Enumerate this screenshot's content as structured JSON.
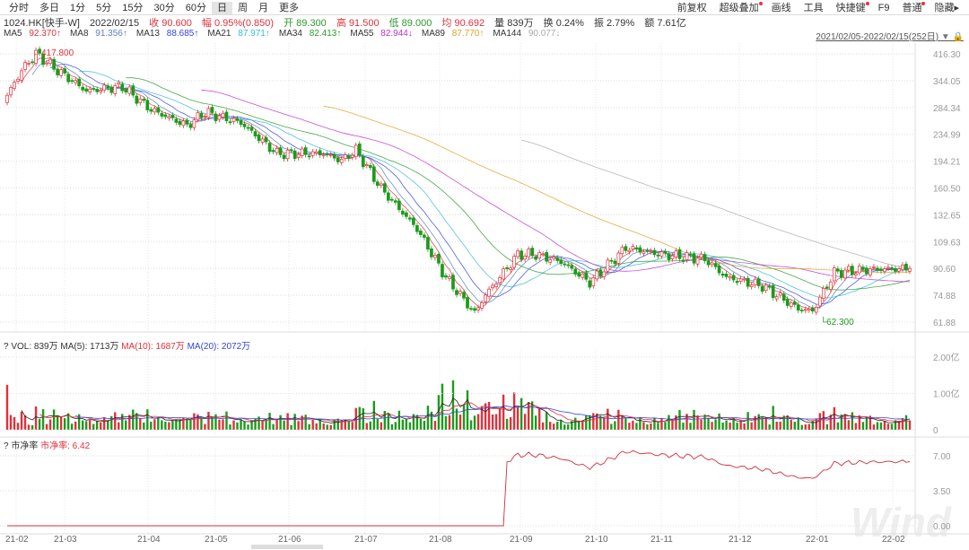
{
  "periods": [
    "分时",
    "多日",
    "1分",
    "5分",
    "15分",
    "30分",
    "60分",
    "日",
    "周",
    "月",
    "更多"
  ],
  "selected_period": "日",
  "tools": [
    {
      "label": "前复权",
      "dot": false
    },
    {
      "label": "超级叠加",
      "dot": true
    },
    {
      "label": "画线",
      "dot": false
    },
    {
      "label": "工具",
      "dot": false
    },
    {
      "label": "快捷键",
      "dot": true
    },
    {
      "label": "F9",
      "dot": false
    },
    {
      "label": "普通",
      "dot": true
    },
    {
      "label": "隐藏▸",
      "dot": false
    }
  ],
  "quote": {
    "code": "1024.HK[快手-W]",
    "date": "2022/02/15",
    "close": "收 90.600",
    "change": "幅 0.95%(0.850)",
    "open": "开 89.300",
    "high": "高 91.500",
    "low": "低 89.000",
    "avg": "均 90.692",
    "vol": "量 839万",
    "turnover": "换 0.24%",
    "amp": "振 2.79%",
    "amount": "额 7.61亿"
  },
  "ma": [
    {
      "label": "MA5",
      "value": "92.370↑",
      "color": "#e0313b"
    },
    {
      "label": "MA8",
      "value": "91.356↑",
      "color": "#5a7fc0"
    },
    {
      "label": "MA13",
      "value": "88.685↑",
      "color": "#3344dd"
    },
    {
      "label": "MA21",
      "value": "87.971↑",
      "color": "#38b8d8"
    },
    {
      "label": "MA34",
      "value": "82.413↑",
      "color": "#2a9a2a"
    },
    {
      "label": "MA55",
      "value": "82.944↓",
      "color": "#c030d0"
    },
    {
      "label": "MA89",
      "value": "87.770↑",
      "color": "#e0a020"
    },
    {
      "label": "MA144",
      "value": "90.077↓",
      "color": "#aaaaaa"
    }
  ],
  "date_range": "2021/02/05-2022/02/15(252日)",
  "volume_header": {
    "q": "?",
    "vol": "VOL: 839万",
    "ma5": "MA(5): 1713万",
    "ma10": "MA(10): 1687万",
    "ma20": "MA(20): 2072万"
  },
  "pb_header": {
    "q": "?",
    "name": "市净率",
    "value": "市净率: 6.42"
  },
  "watermark": "Wind",
  "chart_data": {
    "type": "candlestick",
    "price_axis": {
      "scale": "log",
      "ticks": [
        "416.30",
        "344.05",
        "284.34",
        "234.99",
        "194.21",
        "160.50",
        "132.65",
        "109.63",
        "90.60",
        "74.88",
        "61.88"
      ]
    },
    "x_ticks": [
      "21-02",
      "21-03",
      "21-04",
      "21-05",
      "21-06",
      "21-07",
      "21-08",
      "21-09",
      "21-10",
      "21-11",
      "21-12",
      "22-01",
      "22-02"
    ],
    "annotations": {
      "high": "417.800",
      "low": "62.300"
    },
    "close_path_day_price": [
      [
        0,
        310
      ],
      [
        4,
        370
      ],
      [
        8,
        417
      ],
      [
        14,
        370
      ],
      [
        22,
        320
      ],
      [
        32,
        330
      ],
      [
        40,
        280
      ],
      [
        50,
        250
      ],
      [
        55,
        275
      ],
      [
        65,
        255
      ],
      [
        75,
        205
      ],
      [
        88,
        205
      ],
      [
        93,
        195
      ],
      [
        97,
        210
      ],
      [
        104,
        160
      ],
      [
        114,
        120
      ],
      [
        122,
        85
      ],
      [
        130,
        66
      ],
      [
        133,
        75
      ],
      [
        142,
        100
      ],
      [
        147,
        100
      ],
      [
        154,
        95
      ],
      [
        162,
        82
      ],
      [
        168,
        95
      ],
      [
        172,
        105
      ],
      [
        182,
        100
      ],
      [
        194,
        97
      ],
      [
        200,
        85
      ],
      [
        210,
        80
      ],
      [
        220,
        68
      ],
      [
        224,
        67
      ],
      [
        230,
        88
      ],
      [
        240,
        90
      ],
      [
        251,
        90.6
      ]
    ],
    "volume_axis": {
      "ticks": [
        "2.00亿",
        "1.00亿",
        "0"
      ]
    },
    "pb_axis": {
      "ticks": [
        "7.00",
        "3.50",
        "0.00"
      ]
    },
    "pb_start_day": 139
  }
}
